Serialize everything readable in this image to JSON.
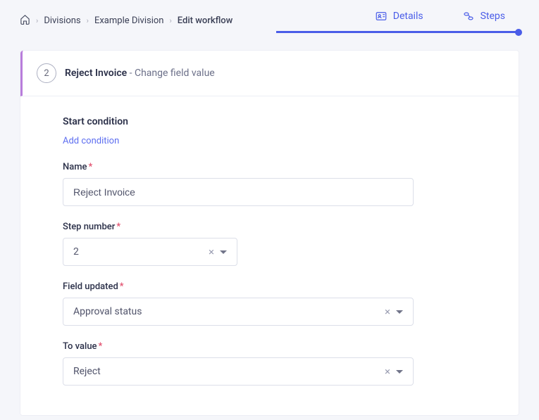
{
  "breadcrumb": {
    "divisions": "Divisions",
    "example_division": "Example Division",
    "edit_workflow": "Edit workflow"
  },
  "tabs": {
    "details": "Details",
    "steps": "Steps"
  },
  "step_header": {
    "number": "2",
    "title": "Reject Invoice",
    "subtitle": " - Change field value"
  },
  "form": {
    "start_condition_label": "Start condition",
    "add_condition": "Add condition",
    "name": {
      "label": "Name",
      "value": "Reject Invoice"
    },
    "step_number": {
      "label": "Step number",
      "value": "2"
    },
    "field_updated": {
      "label": "Field updated",
      "value": "Approval status"
    },
    "to_value": {
      "label": "To value",
      "value": "Reject"
    }
  }
}
